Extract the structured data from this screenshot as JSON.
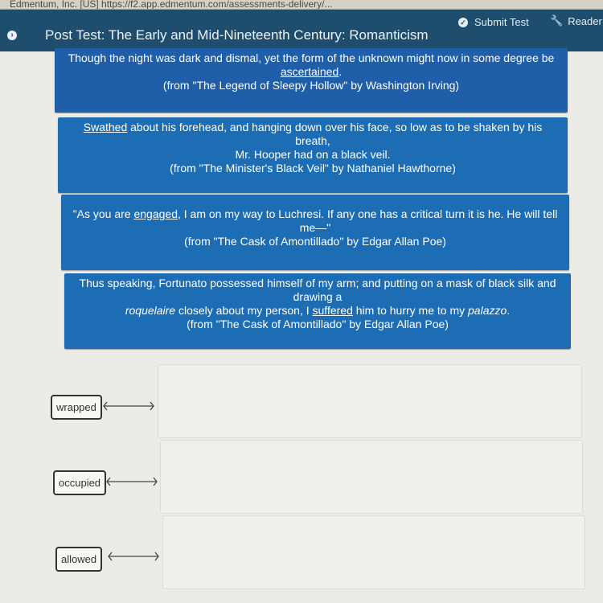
{
  "browser": {
    "url_text": "Edmentum, Inc. [US]  https://f2.app.edmentum.com/assessments-delivery/..."
  },
  "header": {
    "nav_icon": "circle-arrow-icon",
    "title": "Post Test: The Early and Mid-Nineteenth Century: Romanticism",
    "submit_label": "Submit Test",
    "submit_icon": "check-circle-icon",
    "reader_label": "Reader",
    "reader_icon": "wrench-icon"
  },
  "quotes": [
    {
      "before": "Though the night was dark and dismal, yet the form of the unknown might now in some degree be ",
      "underlined": "ascertained",
      "after": ".",
      "source": "(from \"The Legend of Sleepy Hollow\" by Washington Irving)"
    },
    {
      "underlined": "Swathed",
      "after": " about his forehead, and hanging down over his face, so low as to be shaken by his breath,",
      "line2": "Mr. Hooper had on a black veil.",
      "source": "(from \"The Minister's Black Veil\" by Nathaniel Hawthorne)"
    },
    {
      "before": "\"As you are ",
      "underlined": "engaged",
      "after": ", I am on my way to Luchresi. If any one has a critical turn it is he. He will tell me—\"",
      "source": "(from \"The Cask of Amontillado\" by Edgar Allan Poe)"
    },
    {
      "line1": "Thus speaking, Fortunato possessed himself of my arm; and putting on a mask of black silk and drawing a",
      "italic1": "roquelaire",
      "mid": " closely about my person, I ",
      "underlined": "suffered",
      "mid2": " him to hurry me to my ",
      "italic2": "palazzo",
      "end": ".",
      "source": "(from \"The Cask of Amontillado\" by Edgar Allan Poe)"
    }
  ],
  "matching": {
    "tiles": [
      "wrapped",
      "occupied",
      "allowed"
    ],
    "arrow_icon": "double-arrow-icon"
  }
}
